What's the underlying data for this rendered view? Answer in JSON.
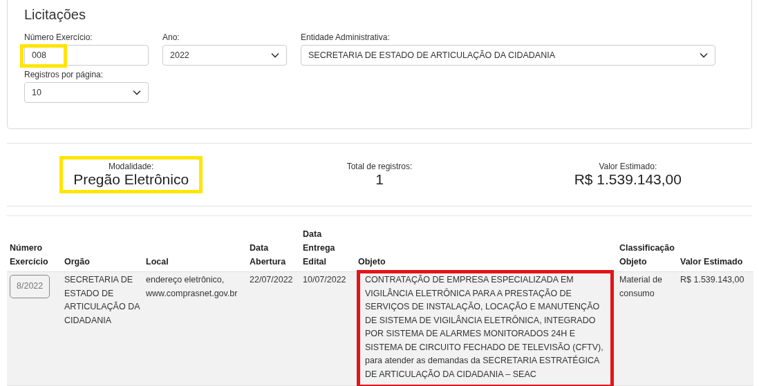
{
  "title": "Licitações",
  "filters": [
    {
      "kind": "text",
      "label": "Número Exercício:",
      "value": "008",
      "highlighted": true
    },
    {
      "kind": "select",
      "label": "Ano:",
      "value": "2022",
      "highlighted": false
    },
    {
      "kind": "select",
      "label": "Entidade Administrativa:",
      "value": "SECRETARIA DE ESTADO DE ARTICULAÇÃO DA CIDADANIA",
      "highlighted": false
    },
    {
      "kind": "select",
      "label": "Registros por página:",
      "value": "10",
      "highlighted": false
    }
  ],
  "summary": [
    {
      "label": "Modalidade:",
      "value": "Pregão Eletrônico",
      "highlighted": true
    },
    {
      "label": "Total de registros:",
      "value": "1",
      "highlighted": false
    },
    {
      "label": "Valor Estimado:",
      "value": "R$ 1.539.143,00",
      "highlighted": false
    }
  ],
  "table": {
    "columns": [
      [
        "Número",
        "Exercício"
      ],
      [
        "Orgão"
      ],
      [
        "Local"
      ],
      [
        "Data",
        "Abertura"
      ],
      [
        "Data",
        "Entrega",
        "Edital"
      ],
      [
        "Objeto"
      ],
      [
        "Classificação",
        "Objeto"
      ],
      [
        "Valor Estimado"
      ]
    ],
    "rows": [
      {
        "numero": "8/2022",
        "orgao": "SECRETARIA DE ESTADO DE ARTICULAÇÃO DA CIDADANIA",
        "local": "endereço eletrônico, www.comprasnet.gov.br",
        "data_abertura": "22/07/2022",
        "data_entrega": "10/07/2022",
        "objeto": "CONTRATAÇÃO DE EMPRESA ESPECIALIZADA EM VIGILÂNCIA ELETRÔNICA PARA A PRESTAÇÃO DE SERVIÇOS DE INSTALAÇÃO, LOCAÇÃO E MANUTENÇÃO DE SISTEMA DE VIGILÂNCIA ELETRÔNICA, INTEGRADO POR SISTEMA DE ALARMES MONITORADOS 24H E SISTEMA DE CIRCUITO FECHADO DE TELEVISÃO (CFTV), para atender as demandas da SECRETARIA ESTRATÉGICA DE ARTICULAÇÃO DA CIDADANIA – SEAC",
        "objeto_highlighted": true,
        "classificacao": "Material de consumo",
        "valor": "R$ 1.539.143,00"
      }
    ]
  }
}
